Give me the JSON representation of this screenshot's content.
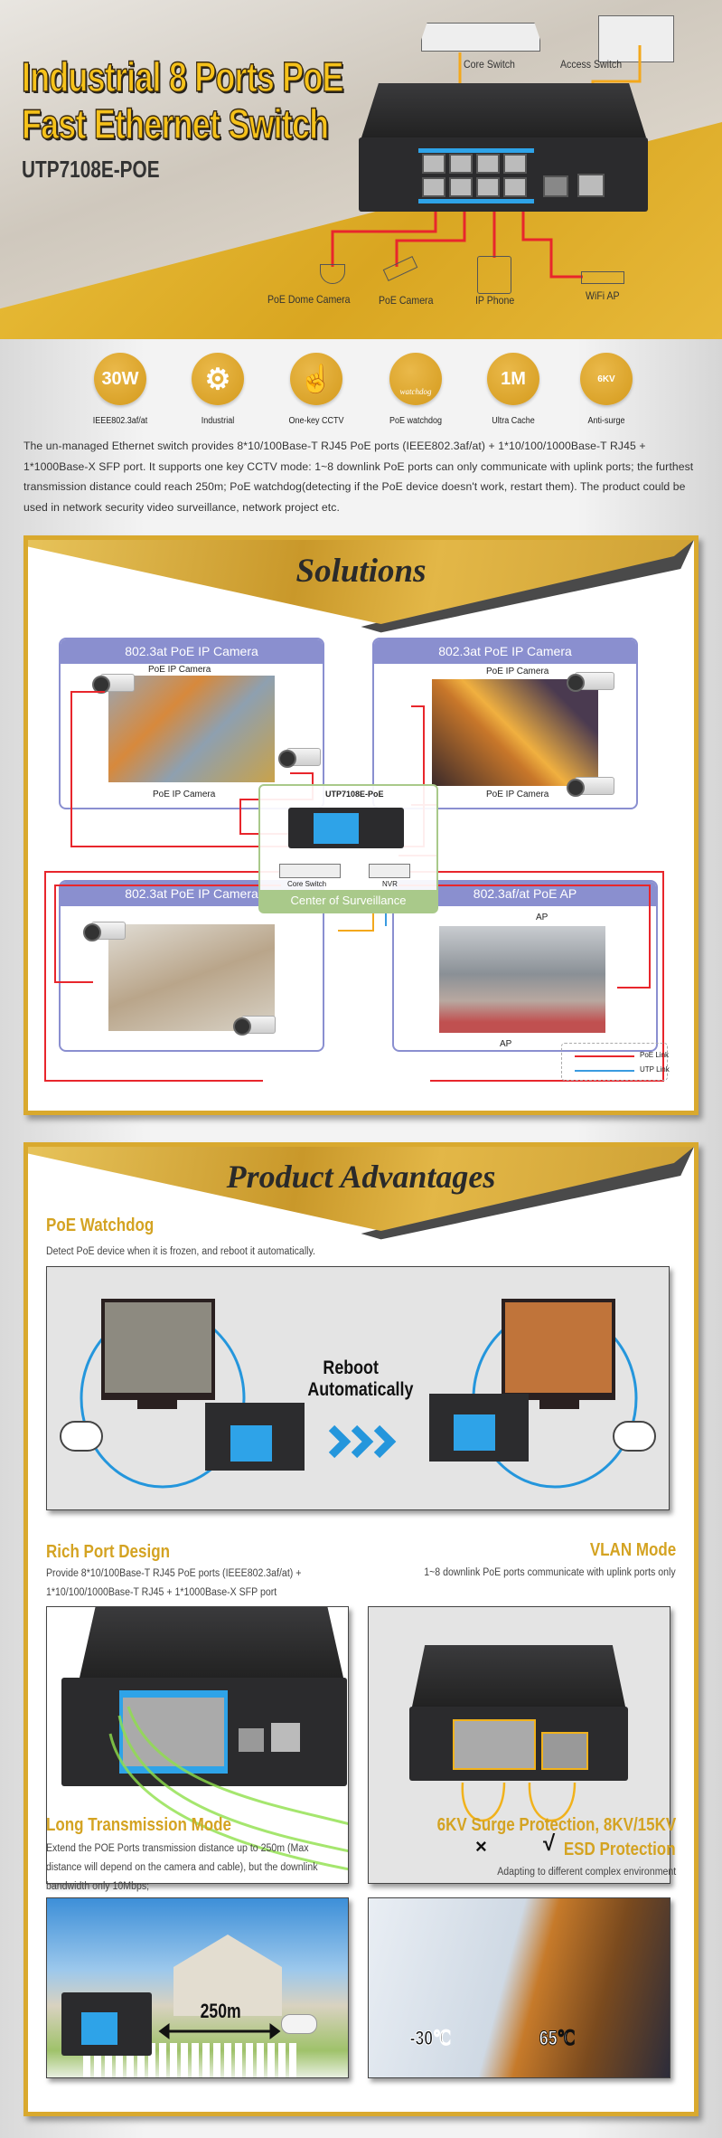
{
  "hero": {
    "title_line1": "Industrial 8 Ports PoE",
    "title_line2": "Fast Ethernet Switch",
    "model": "UTP7108E-POE",
    "devices": {
      "core_switch": "Core Switch",
      "access_switch": "Access Switch",
      "dome_camera": "PoE Dome Camera",
      "poe_camera": "PoE Camera",
      "ip_phone": "IP Phone",
      "wifi_ap": "WiFi AP"
    }
  },
  "features": [
    {
      "icon": "30W",
      "label": "IEEE802.3af/at",
      "icon_name": "power-icon"
    },
    {
      "icon": "⚙",
      "label": "Industrial",
      "icon_name": "gears-icon"
    },
    {
      "icon": "☝",
      "label": "One-key CCTV",
      "icon_name": "hand-press-icon"
    },
    {
      "icon": "watchdog",
      "label": "PoE watchdog",
      "icon_name": "dog-icon"
    },
    {
      "icon": "1M",
      "label": "Ultra Cache",
      "icon_name": "cache-icon"
    },
    {
      "icon": "6KV",
      "label": "Anti-surge",
      "icon_name": "lightning-cloud-icon"
    }
  ],
  "description": "The un-managed Ethernet switch provides 8*10/100Base-T RJ45 PoE ports (IEEE802.3af/at) + 1*10/100/1000Base-T RJ45 + 1*1000Base-X SFP port. It supports one key CCTV mode: 1~8 downlink PoE ports can only communicate with uplink ports; the furthest transmission distance could reach 250m; PoE watchdog(detecting if the PoE device doesn't work, restart them). The product could be used in network security video surveillance, network project etc.",
  "solutions": {
    "title": "Solutions",
    "boxes": [
      {
        "title": "802.3at PoE IP Camera",
        "labels": [
          "PoE IP Camera",
          "PoE IP Camera"
        ]
      },
      {
        "title": "802.3at PoE IP Camera",
        "labels": [
          "PoE IP Camera",
          "PoE IP Camera"
        ]
      },
      {
        "title": "802.3at PoE IP Camera",
        "labels": []
      },
      {
        "title": "802.3af/at PoE AP",
        "labels": [
          "AP",
          "AP"
        ]
      }
    ],
    "center": {
      "model": "UTP7108E-PoE",
      "core_switch": "Core Switch",
      "nvr": "NVR",
      "title": "Center of Surveillance"
    },
    "legend": [
      {
        "label": "PoE Link",
        "color": "#e8262c"
      },
      {
        "label": "UTP Link",
        "color": "#3a9be0"
      }
    ]
  },
  "advantages": {
    "title": "Product Advantages",
    "watchdog": {
      "heading": "PoE Watchdog",
      "desc": "Detect PoE device when it is frozen, and reboot it automatically.",
      "caption1": "Reboot",
      "caption2": "Automatically"
    },
    "rich_port": {
      "heading": "Rich Port Design",
      "desc1": "Provide 8*10/100Base-T RJ45 PoE ports (IEEE802.3af/at) +",
      "desc2": "1*10/100/1000Base-T RJ45 + 1*1000Base-X SFP port"
    },
    "vlan": {
      "heading": "VLAN Mode",
      "desc": "1~8 downlink PoE ports communicate with uplink ports only",
      "cross": "×",
      "check": "√"
    },
    "long_tx": {
      "heading": "Long Transmission Mode",
      "desc1": "Extend the POE Ports transmission distance up to 250m (Max",
      "desc2": "distance will depend on the camera and cable), but the downlink",
      "desc3": "bandwidth only 10Mbps;",
      "distance": "250m"
    },
    "surge": {
      "heading1": "6KV Surge Protection, 8KV/15KV",
      "heading2": "ESD Protection",
      "desc": "Adapting to different complex environment",
      "cold": "-30℃",
      "hot": "65℃"
    }
  },
  "colors": {
    "gold": "#d9a92e",
    "heading_gold": "#d4a322",
    "poe_link": "#e8262c",
    "utp_link": "#3a9be0",
    "box_header": "#8a8fcf"
  }
}
